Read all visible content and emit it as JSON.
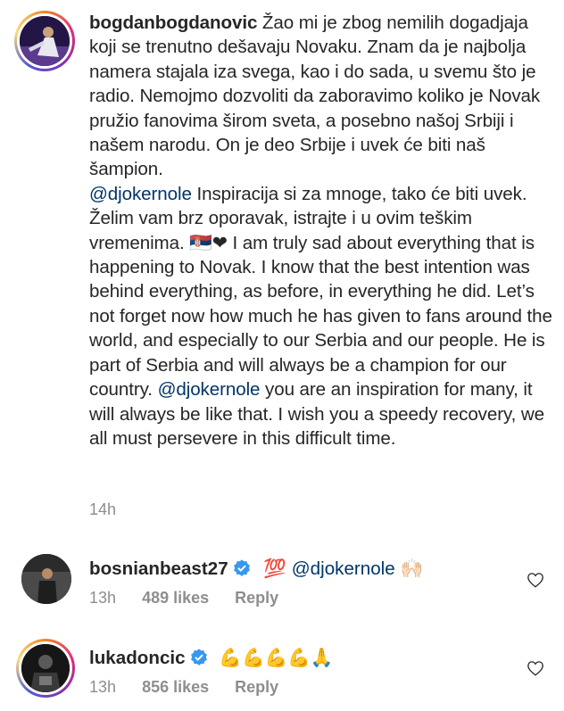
{
  "post": {
    "username": "bogdanbogdanovic",
    "text_1": " Žao mi je zbog nemilih dogadjaja koji se trenutno dešavaju Novaku. Znam da je najbolja namera stajala iza svega, kao i do sada, u svemu što je radio. Nemojmo dozvoliti da zaboravimo koliko je Novak pružio fanovima širom sveta, a posebno našoj Srbiji i našem narodu. On je deo Srbije i uvek će biti naš šampion.",
    "mention_1": "@djokernole",
    "text_2": " Inspiracija si za mnoge, tako će biti uvek. Želim vam brz oporavak, istrajte i u ovim teškim vremenima. ",
    "emoji_1": "🇷🇸❤",
    "text_3": " I am truly sad about everything that is happening to Novak. I know that the best intention was behind everything, as before, in everything he did. Let’s not forget now how much he has given to fans around the world, and especially to our Serbia and our people. He is part of Serbia and will always be a champion for our country. ",
    "mention_2": " @djokernole ",
    "text_4": " you are an inspiration for many, it will always be like that.  I wish you a speedy recovery, we all must persevere in this difficult time.",
    "time": "14h"
  },
  "comments": [
    {
      "username": "bosnianbeast27",
      "emoji_before": "💯",
      "mention": "@djokernole",
      "emoji_after": "🙌🏻",
      "time": "13h",
      "likes": "489 likes",
      "reply": "Reply"
    },
    {
      "username": "lukadoncic",
      "emoji_after": "💪💪💪💪🙏",
      "time": "13h",
      "likes": "856 likes",
      "reply": "Reply"
    }
  ],
  "colors": {
    "mention": "#003569",
    "muted": "#8e8e8e",
    "verified": "#3897f0"
  }
}
